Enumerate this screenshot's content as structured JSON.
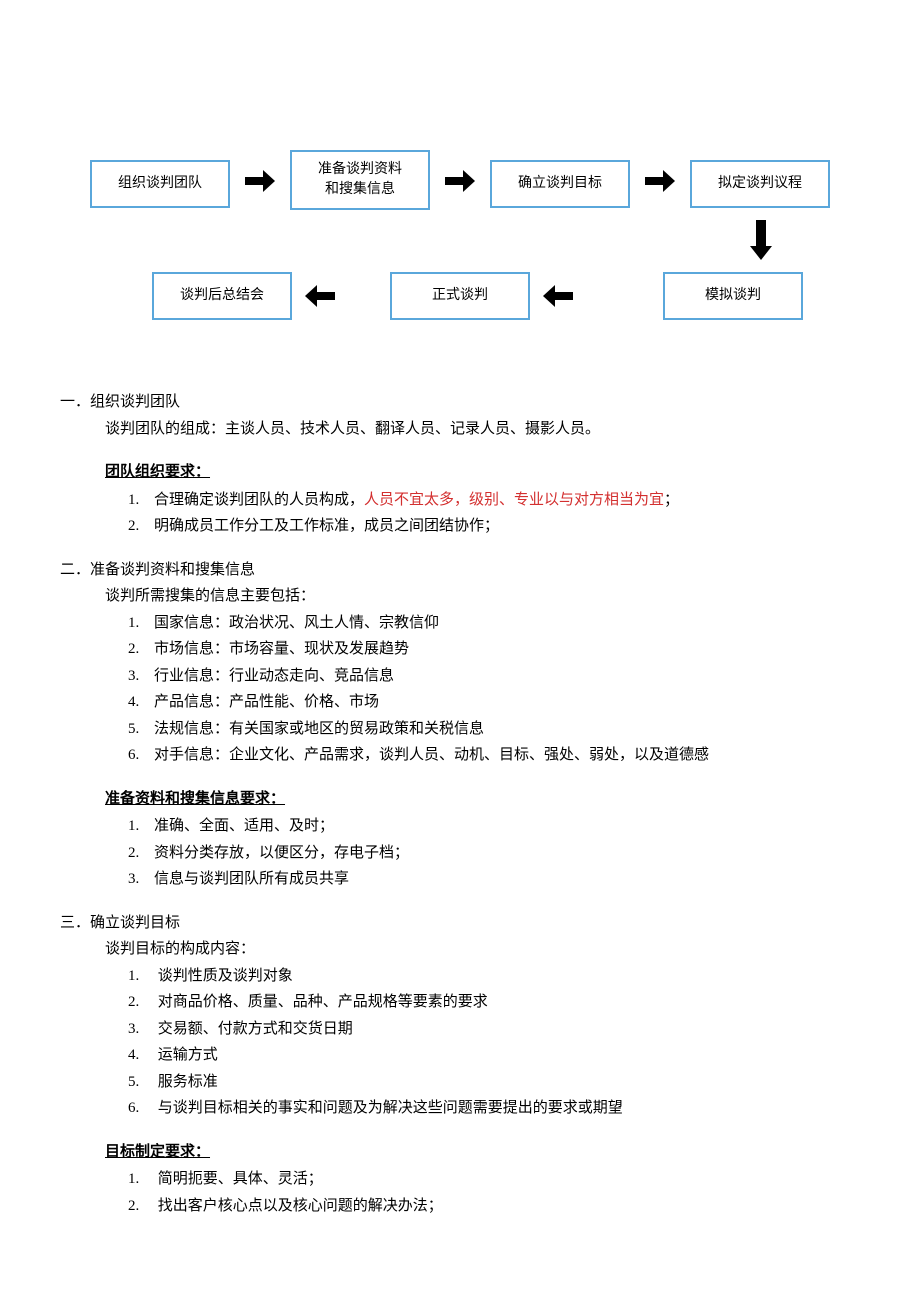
{
  "flow": {
    "box1": "组织谈判团队",
    "box2_l1": "准备谈判资料",
    "box2_l2": "和搜集信息",
    "box3": "确立谈判目标",
    "box4": "拟定谈判议程",
    "box5": "模拟谈判",
    "box6": "正式谈判",
    "box7": "谈判后总结会"
  },
  "s1": {
    "num": "一．",
    "title": "组织谈判团队",
    "intro": "谈判团队的组成：主谈人员、技术人员、翻译人员、记录人员、摄影人员。",
    "req_title": "团队组织要求：",
    "r1_num": "1.",
    "r1a": "合理确定谈判团队的人员构成，",
    "r1b": "人员不宜太多，级别、专业以与对方相当为宜",
    "r1c": "；",
    "r2_num": "2.",
    "r2": "明确成员工作分工及工作标准，成员之间团结协作；"
  },
  "s2": {
    "num": "二．",
    "title": "准备谈判资料和搜集信息",
    "intro": "谈判所需搜集的信息主要包括：",
    "i1_num": "1.",
    "i1": "国家信息：政治状况、风土人情、宗教信仰",
    "i2_num": "2.",
    "i2": "市场信息：市场容量、现状及发展趋势",
    "i3_num": "3.",
    "i3": "行业信息：行业动态走向、竞品信息",
    "i4_num": "4.",
    "i4": "产品信息：产品性能、价格、市场",
    "i5_num": "5.",
    "i5": "法规信息：有关国家或地区的贸易政策和关税信息",
    "i6_num": "6.",
    "i6": "对手信息：企业文化、产品需求，谈判人员、动机、目标、强处、弱处，以及道德感",
    "req_title": "准备资料和搜集信息要求：",
    "r1_num": "1.",
    "r1": "准确、全面、适用、及时；",
    "r2_num": "2.",
    "r2": "资料分类存放，以便区分，存电子档；",
    "r3_num": "3.",
    "r3": "信息与谈判团队所有成员共享"
  },
  "s3": {
    "num": "三．",
    "title": "确立谈判目标",
    "intro": "谈判目标的构成内容：",
    "i1_num": "1.",
    "i1": "谈判性质及谈判对象",
    "i2_num": "2.",
    "i2": "对商品价格、质量、品种、产品规格等要素的要求",
    "i3_num": "3.",
    "i3": "交易额、付款方式和交货日期",
    "i4_num": "4.",
    "i4": "运输方式",
    "i5_num": "5.",
    "i5": "服务标准",
    "i6_num": "6.",
    "i6": "与谈判目标相关的事实和问题及为解决这些问题需要提出的要求或期望",
    "req_title": "目标制定要求：",
    "r1_num": "1.",
    "r1": "简明扼要、具体、灵活；",
    "r2_num": "2.",
    "r2": "找出客户核心点以及核心问题的解决办法；"
  }
}
